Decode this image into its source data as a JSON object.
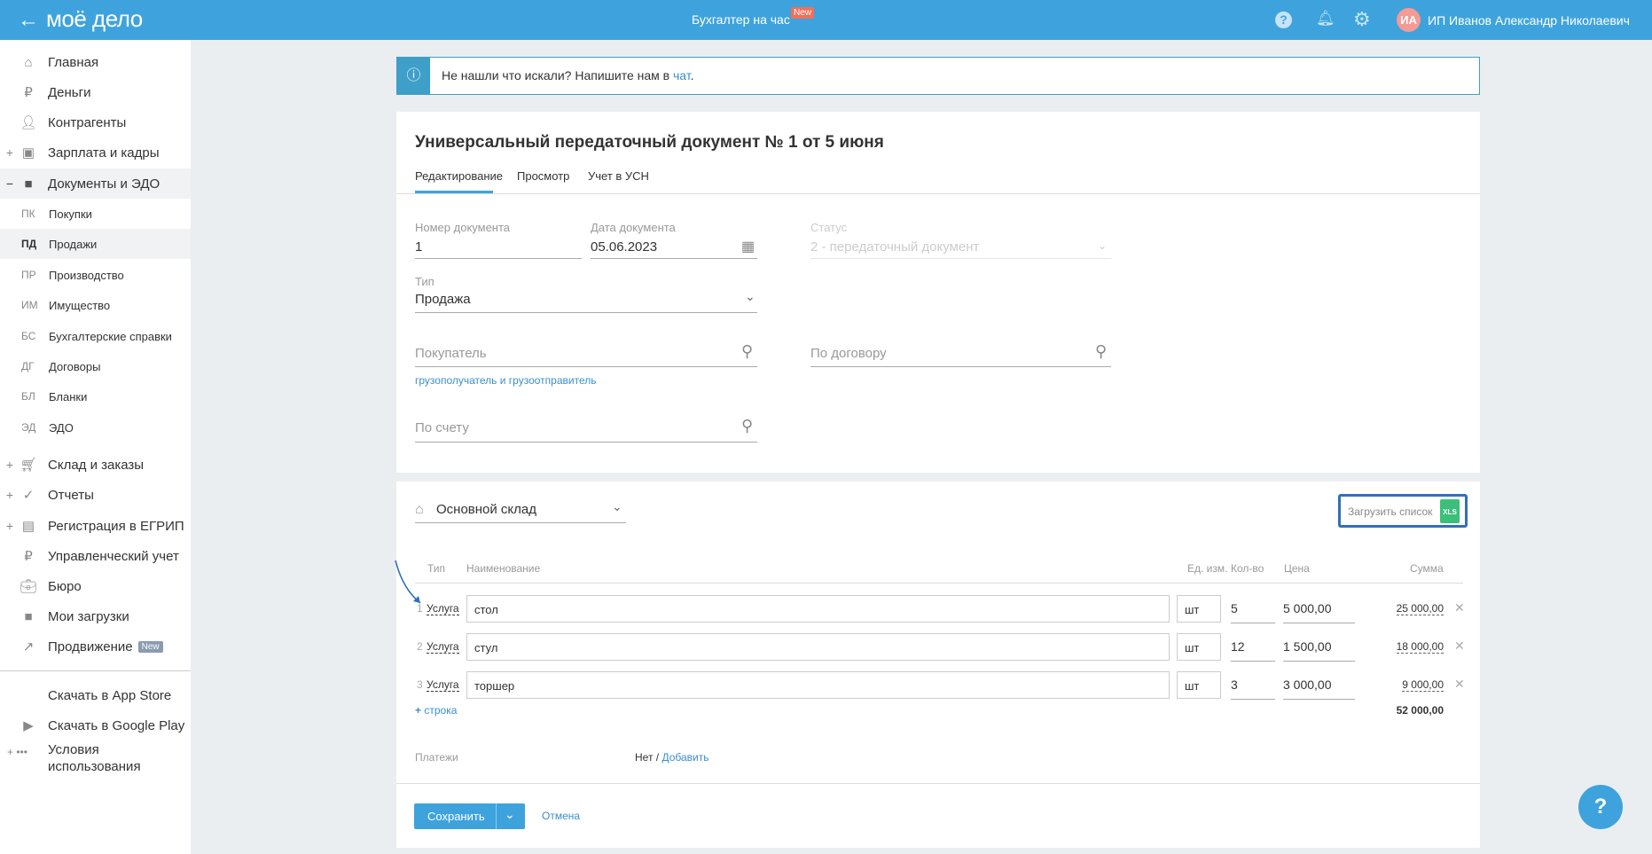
{
  "header": {
    "logo": "моё дело",
    "center_link": "Бухгалтер на час",
    "new_badge": "New",
    "avatar_initials": "ИА",
    "user_name": "ИП Иванов Александр Николаевич"
  },
  "sidebar": {
    "items": [
      {
        "label": "Главная",
        "prefix": ""
      },
      {
        "label": "Деньги",
        "prefix": ""
      },
      {
        "label": "Контрагенты",
        "prefix": ""
      },
      {
        "label": "Зарплата и кадры",
        "prefix": "+"
      },
      {
        "label": "Документы и ЭДО",
        "prefix": "−"
      }
    ],
    "sub_items": [
      {
        "abbr": "ПК",
        "label": "Покупки"
      },
      {
        "abbr": "ПД",
        "label": "Продажи"
      },
      {
        "abbr": "ПР",
        "label": "Производство"
      },
      {
        "abbr": "ИМ",
        "label": "Имущество"
      },
      {
        "abbr": "БС",
        "label": "Бухгалтерские справки"
      },
      {
        "abbr": "ДГ",
        "label": "Договоры"
      },
      {
        "abbr": "БЛ",
        "label": "Бланки"
      },
      {
        "abbr": "ЭД",
        "label": "ЭДО"
      }
    ],
    "items2": [
      {
        "label": "Склад и заказы",
        "prefix": "+"
      },
      {
        "label": "Отчеты",
        "prefix": "+"
      },
      {
        "label": "Регистрация в ЕГРИП",
        "prefix": "+"
      },
      {
        "label": "Управленческий учет",
        "prefix": ""
      },
      {
        "label": "Бюро",
        "prefix": ""
      },
      {
        "label": "Мои загрузки",
        "prefix": ""
      },
      {
        "label": "Продвижение",
        "prefix": "",
        "badge": "New"
      }
    ],
    "apps": [
      {
        "label": "Скачать в App Store"
      },
      {
        "label": "Скачать в Google Play"
      }
    ],
    "terms": {
      "prefix": "+ •••",
      "line1": "Условия",
      "line2": "использования"
    }
  },
  "banner": {
    "text": "Не нашли что искали? Напишите нам в ",
    "link": "чат",
    "end": "."
  },
  "document": {
    "title": "Универсальный передаточный документ № 1 от 5 июня",
    "tabs": [
      "Редактирование",
      "Просмотр",
      "Учет в УСН"
    ],
    "number_label": "Номер документа",
    "number": "1",
    "date_label": "Дата документа",
    "date": "05.06.2023",
    "status_label": "Статус",
    "status": "2 - передаточный документ",
    "type_label": "Тип",
    "type": "Продажа",
    "buyer_placeholder": "Покупатель",
    "contract_placeholder": "По договору",
    "consignee_link": "грузополучатель и грузоотправитель",
    "invoice_placeholder": "По счету"
  },
  "items": {
    "warehouse": "Основной склад",
    "upload_button": "Загрузить список",
    "xls": "XLS",
    "headers": [
      "Тип",
      "Наименование",
      "Ед. изм.",
      "Кол-во",
      "Цена",
      "Сумма"
    ],
    "rows": [
      {
        "n": "1",
        "type": "Услуга",
        "name": "стол",
        "unit": "шт",
        "qty": "5",
        "price": "5 000,00",
        "sum": "25 000,00"
      },
      {
        "n": "2",
        "type": "Услуга",
        "name": "стул",
        "unit": "шт",
        "qty": "12",
        "price": "1 500,00",
        "sum": "18 000,00"
      },
      {
        "n": "3",
        "type": "Услуга",
        "name": "торшер",
        "unit": "шт",
        "qty": "3",
        "price": "3 000,00",
        "sum": "9 000,00"
      }
    ],
    "add_row": "строка",
    "total": "52 000,00",
    "payments_label": "Платежи",
    "payments_value": "Нет",
    "payments_sep": " / ",
    "payments_add": "Добавить"
  },
  "footer": {
    "save": "Сохранить",
    "cancel": "Отмена"
  }
}
